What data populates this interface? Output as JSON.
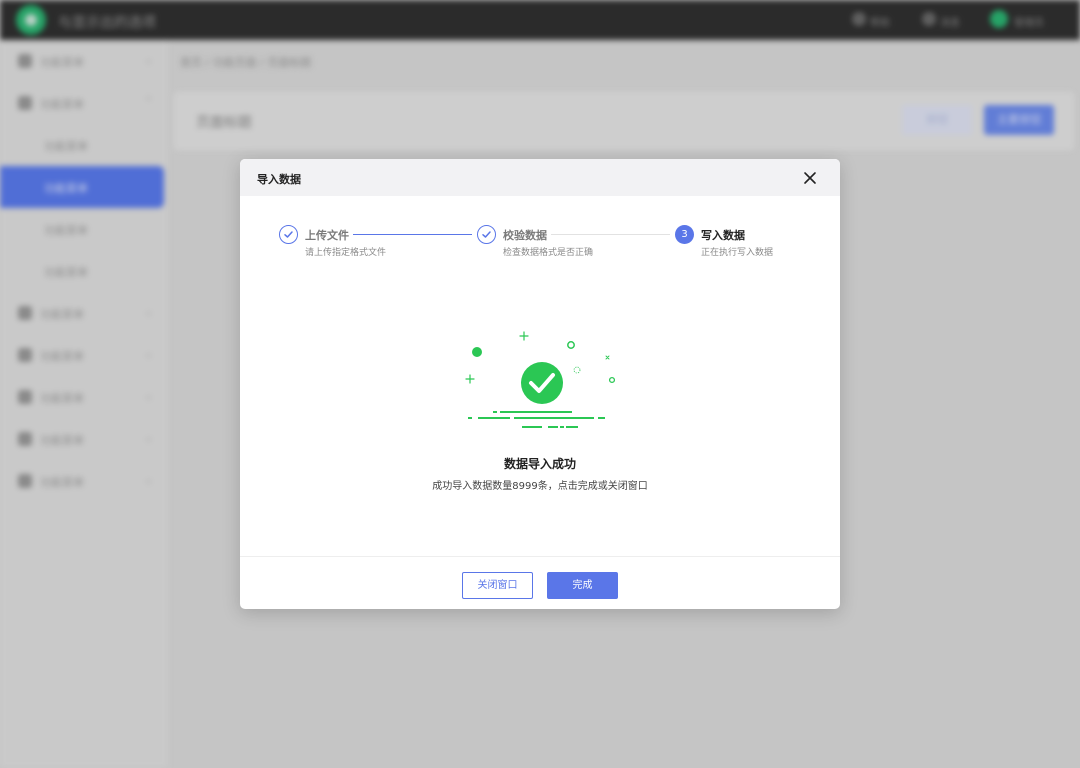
{
  "background": {
    "app_name": "与显示出的选项",
    "topbar_items": [
      "帮助",
      "消息",
      "管理员"
    ],
    "sidebar": {
      "items": [
        {
          "label": "功能菜单",
          "sub": false,
          "active": false
        },
        {
          "label": "功能菜单",
          "sub": false,
          "active": false
        },
        {
          "label": "功能菜单",
          "sub": true,
          "active": false
        },
        {
          "label": "功能菜单",
          "sub": true,
          "active": true
        },
        {
          "label": "功能菜单",
          "sub": true,
          "active": false
        },
        {
          "label": "功能菜单",
          "sub": true,
          "active": false
        },
        {
          "label": "功能菜单",
          "sub": false,
          "active": false
        },
        {
          "label": "功能菜单",
          "sub": false,
          "active": false
        },
        {
          "label": "功能菜单",
          "sub": false,
          "active": false
        },
        {
          "label": "功能菜单",
          "sub": false,
          "active": false
        },
        {
          "label": "功能菜单",
          "sub": false,
          "active": false
        }
      ]
    },
    "breadcrumb": "首页 / 功能页面 / 页面标题",
    "page_title": "页面标题",
    "ghost_button": "按钮",
    "primary_button": "主要按钮"
  },
  "modal": {
    "title": "导入数据",
    "steps": [
      {
        "title": "上传文件",
        "desc": "请上传指定格式文件",
        "status": "done"
      },
      {
        "title": "校验数据",
        "desc": "检查数据格式是否正确",
        "status": "done"
      },
      {
        "number": "3",
        "title": "写入数据",
        "desc": "正在执行写入数据",
        "status": "current"
      }
    ],
    "result_title": "数据导入成功",
    "result_desc": "成功导入数据数量8999条，点击完成或关闭窗口",
    "close_button": "关闭窗口",
    "done_button": "完成"
  },
  "colors": {
    "primary": "#5a76e8",
    "success": "#2bc754",
    "topbar": "#303030"
  }
}
